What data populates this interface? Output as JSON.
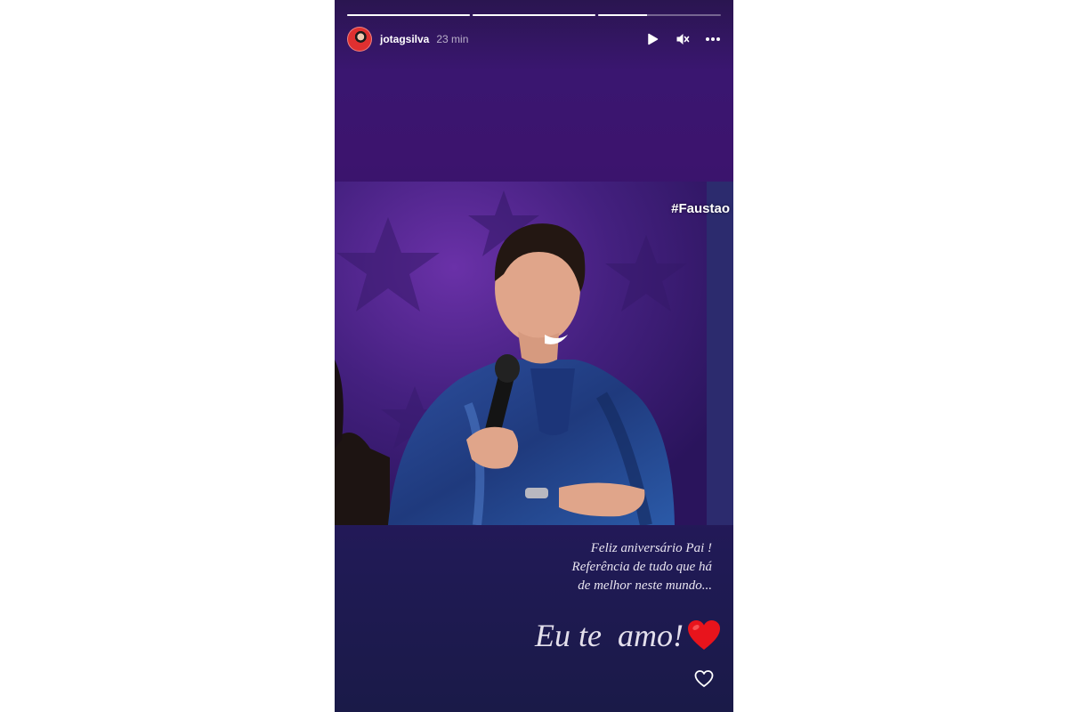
{
  "story": {
    "username": "jotagsilva",
    "time": "23 min",
    "progress": [
      1.0,
      1.0,
      0.4
    ],
    "hashtag": "#Faustao",
    "caption_lines": [
      "Feliz aniversário Pai !",
      "Referência de tudo que há",
      "de melhor neste mundo..."
    ],
    "love_text": "Eu te  amo!"
  },
  "icons": {
    "play": "play-icon",
    "mute": "mute-icon",
    "more": "more-icon",
    "heart_emoji": "heart-emoji-icon",
    "like": "heart-outline-icon"
  },
  "colors": {
    "accent_heart": "#e8141c",
    "background_purple": "#3c146e"
  }
}
